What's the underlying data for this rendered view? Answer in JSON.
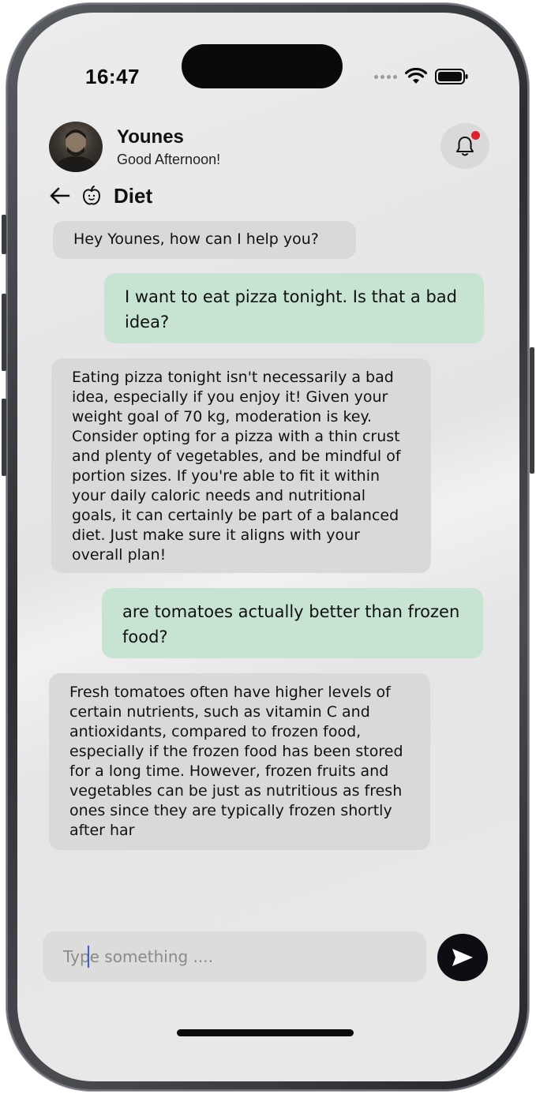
{
  "status_bar": {
    "time": "16:47"
  },
  "header": {
    "user_name": "Younes",
    "greeting": "Good Afternoon!",
    "notification_dot_color": "#e0202a"
  },
  "topic": {
    "title": "Diet",
    "icon": "apple-icon"
  },
  "messages": [
    {
      "role": "assistant",
      "text": "Hey Younes, how can I help you?"
    },
    {
      "role": "user",
      "text": "I want to eat pizza tonight. Is that a bad idea?"
    },
    {
      "role": "assistant",
      "text": "Eating pizza tonight isn't necessarily a bad idea, especially if you enjoy it! Given your weight goal of 70 kg, moderation is key. Consider opting for a pizza with a thin crust and plenty of vegetables, and be mindful of portion sizes. If you're able to fit it within your daily caloric needs and nutritional goals, it can certainly be part of a balanced diet. Just make sure it aligns with your overall plan!"
    },
    {
      "role": "user",
      "text": "are tomatoes actually better than frozen food?"
    },
    {
      "role": "assistant",
      "text": "Fresh tomatoes often have higher levels of certain nutrients, such as vitamin C and antioxidants, compared to frozen food, especially if the frozen food has been stored for a long time. However, frozen fruits and vegetables can be just as nutritious as fresh ones since they are typically frozen shortly after har"
    }
  ],
  "composer": {
    "placeholder": "Type something ....",
    "value": ""
  },
  "colors": {
    "assistant_bubble": "#d9d9db",
    "user_bubble": "#c6e4d1",
    "send_button": "#0c0e14"
  }
}
